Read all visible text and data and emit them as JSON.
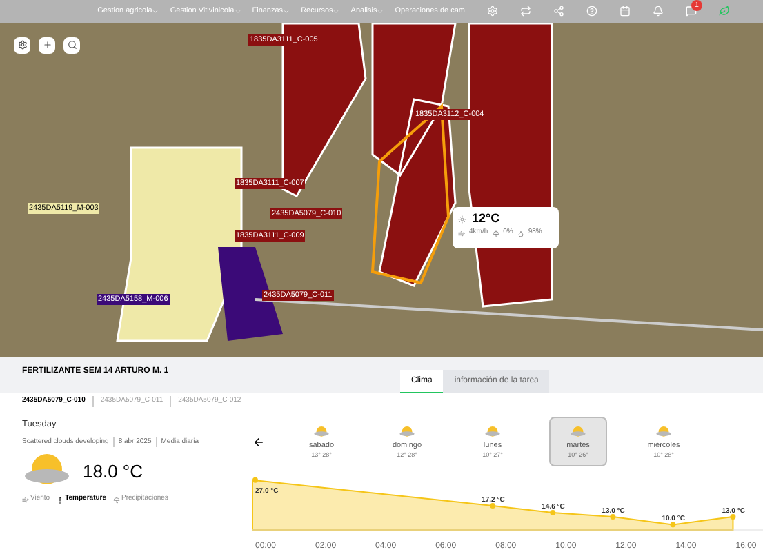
{
  "nav": {
    "items": [
      {
        "label": "Gestion agricola",
        "caret": true
      },
      {
        "label": "Gestion Vitivinicola",
        "caret": true
      },
      {
        "label": "Finanzas",
        "caret": true
      },
      {
        "label": "Recursos",
        "caret": true
      },
      {
        "label": "Analisis",
        "caret": true
      },
      {
        "label": "Operaciones de cam",
        "caret": false
      }
    ],
    "notification_badge": "1"
  },
  "map": {
    "field_labels": [
      {
        "label": "1835DA3111_C-005",
        "color": "#8b1010"
      },
      {
        "label": "1835DA3112_C-004",
        "color": "#8b1010"
      },
      {
        "label": "1835DA3111_C-007",
        "color": "#8b1010"
      },
      {
        "label": "2435DA5079_C-010",
        "color": "#8b1010"
      },
      {
        "label": "1835DA3111_C-009",
        "color": "#8b1010"
      },
      {
        "label": "2435DA5079_C-011",
        "color": "#8b1010"
      },
      {
        "label": "2435DA5119_M-003",
        "color": "#efe9a8"
      },
      {
        "label": "2435DA5158_M-006",
        "color": "#3b0a78"
      }
    ],
    "popup": {
      "temperature": "12°C",
      "wind": "4km/h",
      "rain": "0%",
      "humidity": "98%"
    }
  },
  "panel": {
    "title": "FERTILIZANTE SEM 14 ARTURO M. 1",
    "tabs": [
      {
        "label": "Clima",
        "selected": true
      },
      {
        "label": "información de la tarea",
        "selected": false
      }
    ],
    "plots": [
      {
        "label": "2435DA5079_C-010",
        "selected": true
      },
      {
        "label": "2435DA5079_C-011",
        "selected": false
      },
      {
        "label": "2435DA5079_C-012",
        "selected": false
      }
    ],
    "day": "Tuesday",
    "summary": [
      "Scattered clouds developing",
      "8 abr 2025",
      "Media diaria"
    ],
    "temperature": "18.0 °C",
    "modes": [
      {
        "label": "Viento",
        "selected": false
      },
      {
        "label": "Temperature",
        "selected": true
      },
      {
        "label": "Precipitaciones",
        "selected": false
      }
    ],
    "days": [
      {
        "name": "sábado",
        "range": "13° 28°",
        "selected": false
      },
      {
        "name": "domingo",
        "range": "12° 28°",
        "selected": false
      },
      {
        "name": "lunes",
        "range": "10° 27°",
        "selected": false
      },
      {
        "name": "martes",
        "range": "10° 26°",
        "selected": true
      },
      {
        "name": "miércoles",
        "range": "10° 28°",
        "selected": false
      }
    ],
    "temperature_chart": {
      "point_labels": [
        "27.0 °C",
        "17.2 °C",
        "14.6 °C",
        "13.0 °C",
        "10.0 °C",
        "13.0 °C"
      ],
      "hour_labels": [
        "00:00",
        "02:00",
        "04:00",
        "06:00",
        "08:00",
        "10:00",
        "12:00",
        "14:00",
        "16:00"
      ]
    }
  }
}
